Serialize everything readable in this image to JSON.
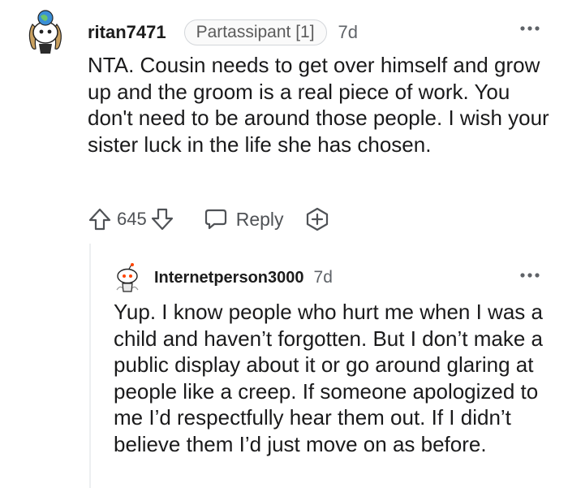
{
  "comments": [
    {
      "username": "ritan7471",
      "flair": "Partassipant [1]",
      "time": "7d",
      "body": "NTA. Cousin needs to get over himself and grow up and the groom is a real piece of work. You don't need to be around those people. I wish your sister luck in the life she has chosen.",
      "votes": "645",
      "reply_label": "Reply",
      "avatar_icon": "snoo-avatar-icon",
      "more_icon": "more-options-icon"
    },
    {
      "username": "Internetperson3000",
      "time": "7d",
      "body": "Yup. I know people who hurt me when I was a child and haven’t forgotten. But I don’t make a public display about it or go around glaring at people like a creep. If someone apologized to me I’d respectfully hear them out. If I didn’t believe them I’d just move on as before.",
      "avatar_icon": "snoo-avatar-icon",
      "more_icon": "more-options-icon"
    }
  ],
  "colors": {
    "text": "#1a1a1b",
    "meta": "#5f6368",
    "thread_line": "#edeff1",
    "avatar_blue": "#3a8fd6"
  }
}
